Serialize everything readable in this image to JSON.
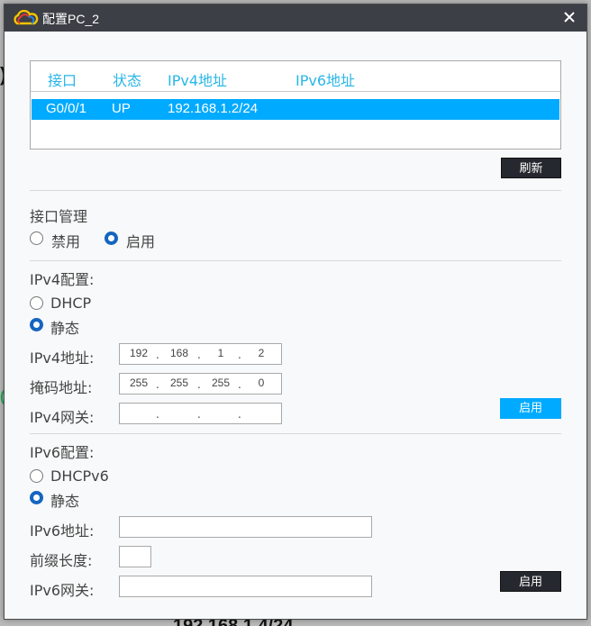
{
  "window": {
    "title": "配置PC_2"
  },
  "interfaces": {
    "headers": [
      "接口",
      "状态",
      "IPv4地址",
      "IPv6地址"
    ],
    "rows": [
      {
        "iface": "G0/0/1",
        "status": "UP",
        "ipv4": "192.168.1.2/24",
        "ipv6": ""
      }
    ],
    "refresh_label": "刷新"
  },
  "iface_mgmt": {
    "title": "接口管理",
    "disable_label": "禁用",
    "enable_label": "启用",
    "selected": "enable"
  },
  "ipv4": {
    "title": "IPv4配置:",
    "dhcp_label": "DHCP",
    "static_label": "静态",
    "selected": "static",
    "addr_label": "IPv4地址:",
    "addr": [
      "192",
      "168",
      "1",
      "2"
    ],
    "mask_label": "掩码地址:",
    "mask": [
      "255",
      "255",
      "255",
      "0"
    ],
    "gw_label": "IPv4网关:",
    "gw": [
      "",
      "",
      "",
      ""
    ],
    "apply_label": "启用"
  },
  "ipv6": {
    "title": "IPv6配置:",
    "dhcp_label": "DHCPv6",
    "static_label": "静态",
    "selected": "static",
    "addr_label": "IPv6地址:",
    "addr": "",
    "prefix_label": "前缀长度:",
    "prefix": "",
    "gw_label": "IPv6网关:",
    "gw": "",
    "apply_label": "启用"
  },
  "background": {
    "text": "192.168.1.4/24"
  },
  "colors": {
    "accent": "#00aaff",
    "header_text": "#29b6e8",
    "titlebar": "#3c3f45",
    "radio_on": "#1565c0"
  }
}
